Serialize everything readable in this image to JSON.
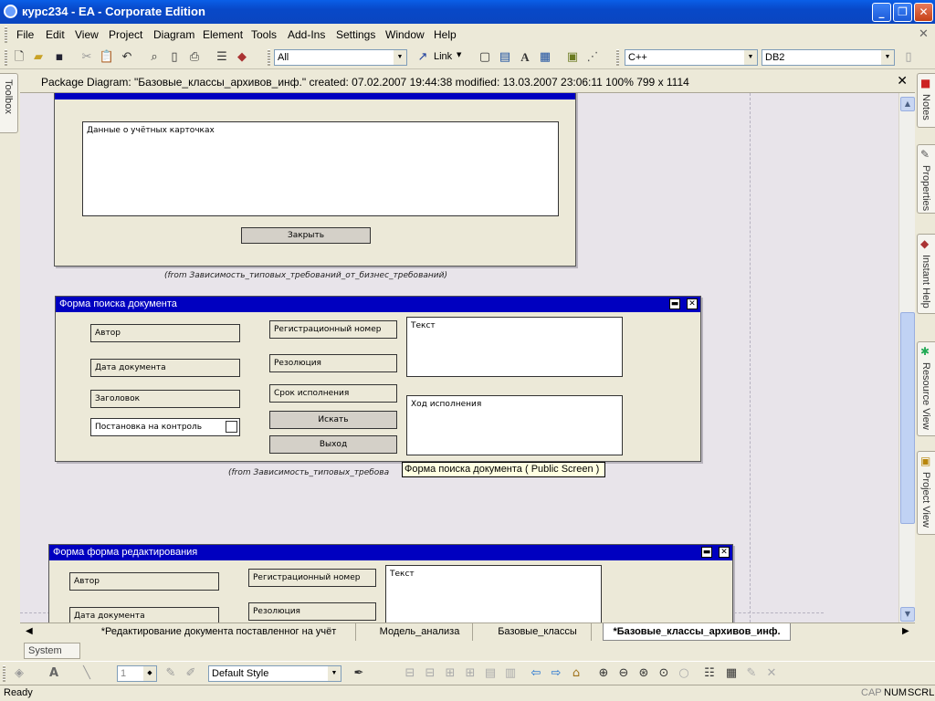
{
  "window": {
    "title": "курс234 - EA - Corporate Edition",
    "controls": {
      "minimize": "_",
      "maximize": "❐",
      "close": "✕"
    }
  },
  "menu": [
    "File",
    "Edit",
    "View",
    "Project",
    "Diagram",
    "Element",
    "Tools",
    "Add-Ins",
    "Settings",
    "Window",
    "Help"
  ],
  "toolbar": {
    "filter_value": "All",
    "link_label": "Link",
    "language_value": "C++",
    "database_value": "DB2"
  },
  "left_panel": {
    "toolbox_label": "Toolbox"
  },
  "right_panel": {
    "tabs": [
      "Notes",
      "Properties",
      "Instant Help",
      "Resource View",
      "Project View"
    ]
  },
  "diagram_header": {
    "text": "Package Diagram: \"Базовые_классы_архивов_инф.\"  created: 07.02.2007 19:44:38  modified: 13.03.2007 23:06:11   100%   799 x 1114",
    "close": "✕"
  },
  "diagram": {
    "card_form": {
      "memo_text": "Данные о учётных карточках",
      "close_button": "Закрыть",
      "from_note": "(from Зависимость_типовых_требований_от_бизнес_требований)"
    },
    "search_form": {
      "title": "Форма поиска документа",
      "fields_left": [
        "Автор",
        "Дата документа",
        "Заголовок",
        "Постановка на контроль"
      ],
      "fields_mid": [
        "Регистрационный номер",
        "Резолюция",
        "Срок исполнения"
      ],
      "search_button": "Искать",
      "exit_button": "Выход",
      "memo_text": "Текст",
      "memo_progress": "Ход исполнения",
      "from_note": "(from Зависимость_типовых_требова"
    },
    "edit_form": {
      "title": "Форма форма редактирования",
      "fields_left": [
        "Автор",
        "Дата документа"
      ],
      "fields_mid": [
        "Регистрационный номер",
        "Резолюция"
      ],
      "memo_text": "Текст"
    },
    "tooltip": "Форма поиска документа ( Public Screen )"
  },
  "doc_tabs": [
    {
      "label": "*Редактирование документа поставленног на учёт",
      "active": false
    },
    {
      "label": "Модель_анализа",
      "active": false
    },
    {
      "label": "Базовые_классы",
      "active": false
    },
    {
      "label": "*Базовые_классы_архивов_инф.",
      "active": true
    }
  ],
  "system_tab": "System",
  "bottom_toolbar": {
    "zoom_value": "1",
    "style_value": "Default Style"
  },
  "status": {
    "left": "Ready",
    "caps": "CAP",
    "num": "NUM",
    "scrl": "SCRL"
  }
}
